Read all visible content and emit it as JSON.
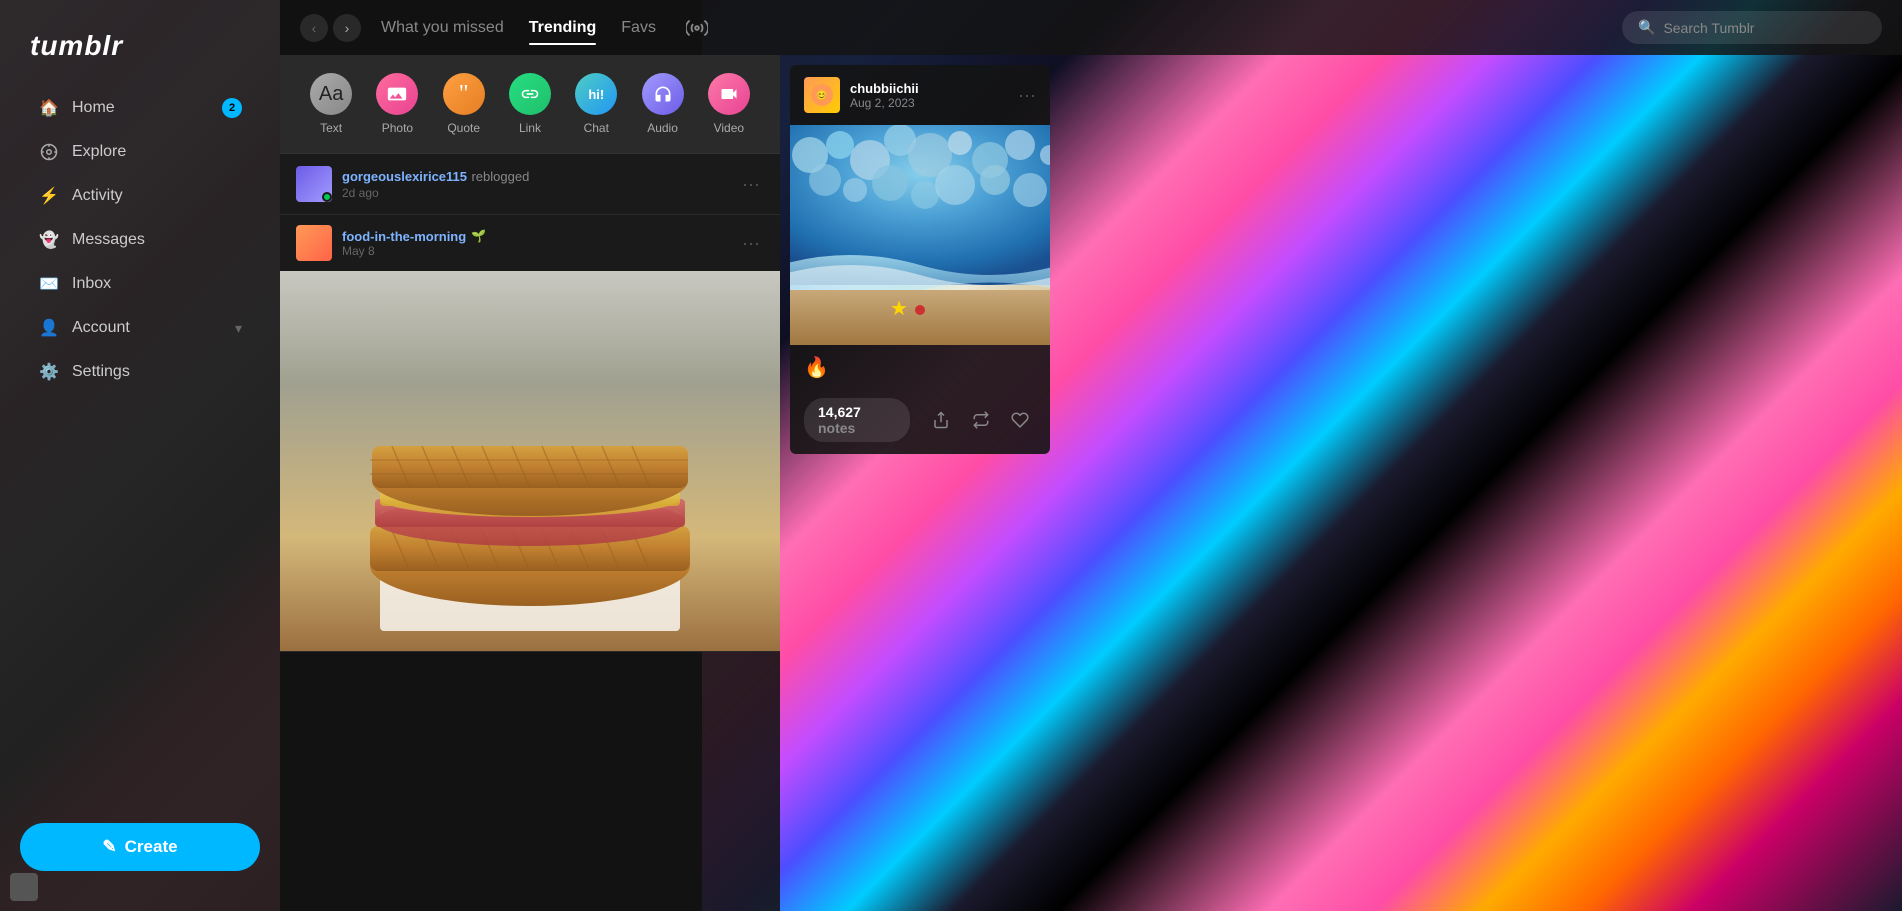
{
  "app": {
    "logo": "tumblr",
    "title": "Tumblr"
  },
  "sidebar": {
    "nav_items": [
      {
        "id": "home",
        "label": "Home",
        "icon": "🏠",
        "badge": "2"
      },
      {
        "id": "explore",
        "label": "Explore",
        "icon": "🔭",
        "badge": null
      },
      {
        "id": "activity",
        "label": "Activity",
        "icon": "⚡",
        "badge": null
      },
      {
        "id": "messages",
        "label": "Messages",
        "icon": "👻",
        "badge": null
      },
      {
        "id": "inbox",
        "label": "Inbox",
        "icon": "✉️",
        "badge": null
      },
      {
        "id": "account",
        "label": "Account",
        "icon": "👤",
        "badge": null,
        "chevron": true
      },
      {
        "id": "settings",
        "label": "Settings",
        "icon": "⚙️",
        "badge": null
      }
    ],
    "create_button": "✎ Create"
  },
  "top_nav": {
    "tabs": [
      {
        "id": "missed",
        "label": "What you missed",
        "active": false
      },
      {
        "id": "trending",
        "label": "Trending",
        "active": true
      },
      {
        "id": "favs",
        "label": "Favs",
        "active": false
      }
    ],
    "search_placeholder": "Search Tumblr"
  },
  "composer": {
    "tools": [
      {
        "id": "text",
        "label": "Text",
        "icon": "Aa",
        "class": "tool-text"
      },
      {
        "id": "photo",
        "label": "Photo",
        "icon": "📷",
        "class": "tool-photo"
      },
      {
        "id": "quote",
        "label": "Quote",
        "icon": "❝",
        "class": "tool-quote"
      },
      {
        "id": "link",
        "label": "Link",
        "icon": "🔗",
        "class": "tool-link"
      },
      {
        "id": "chat",
        "label": "Chat",
        "icon": "hi!",
        "class": "tool-chat"
      },
      {
        "id": "audio",
        "label": "Audio",
        "icon": "🎧",
        "class": "tool-audio"
      },
      {
        "id": "video",
        "label": "Video",
        "icon": "📹",
        "class": "tool-video"
      }
    ]
  },
  "post": {
    "reblogger": "gorgeouslexirice115",
    "reblog_action": "reblogged",
    "reblog_time": "2d ago",
    "original_author": "food-in-the-morning",
    "original_time": "May 8",
    "has_online_indicator": true
  },
  "right_card": {
    "author": "chubbiichii",
    "date": "Aug 2, 2023",
    "notes_count": "14,627",
    "notes_label": "notes"
  }
}
